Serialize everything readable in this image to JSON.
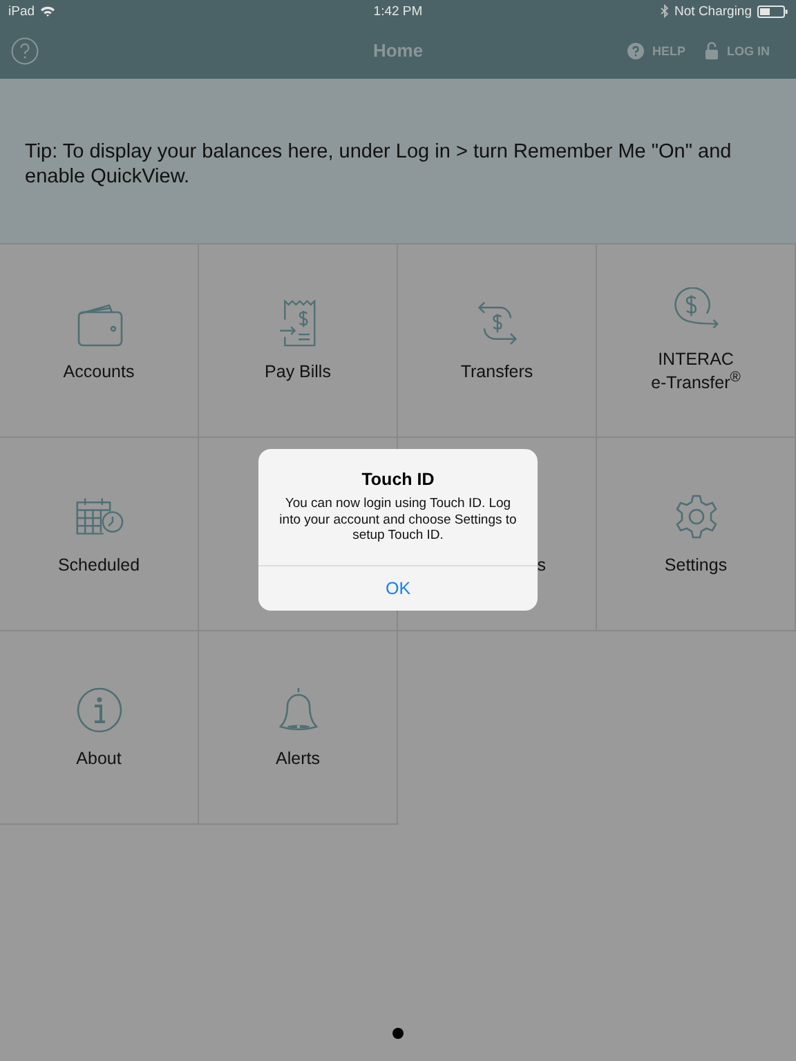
{
  "status_bar": {
    "device": "iPad",
    "time": "1:42 PM",
    "charging": "Not Charging"
  },
  "header": {
    "title": "Home",
    "help": "HELP",
    "login": "LOG IN"
  },
  "tip": "Tip: To display your balances here, under Log in > turn Remember Me \"On\" and enable QuickView.",
  "tiles": [
    {
      "kind": "wallet",
      "label": "Accounts"
    },
    {
      "kind": "bill",
      "label": "Pay Bills"
    },
    {
      "kind": "transfer",
      "label": "Transfers"
    },
    {
      "kind": "etransfer",
      "label": "INTERAC\ne-Transfer$^{®}$"
    },
    {
      "kind": "calendar",
      "label": "Scheduled"
    },
    {
      "kind": "hidden"
    },
    {
      "kind": "partial",
      "label": "s"
    },
    {
      "kind": "gear",
      "label": "Settings"
    },
    {
      "kind": "info",
      "label": "About"
    },
    {
      "kind": "bell",
      "label": "Alerts"
    }
  ],
  "dialog": {
    "title": "Touch ID",
    "message": "You can now login using Touch ID. Log into your account and choose Settings to setup Touch ID.",
    "button": "OK"
  }
}
